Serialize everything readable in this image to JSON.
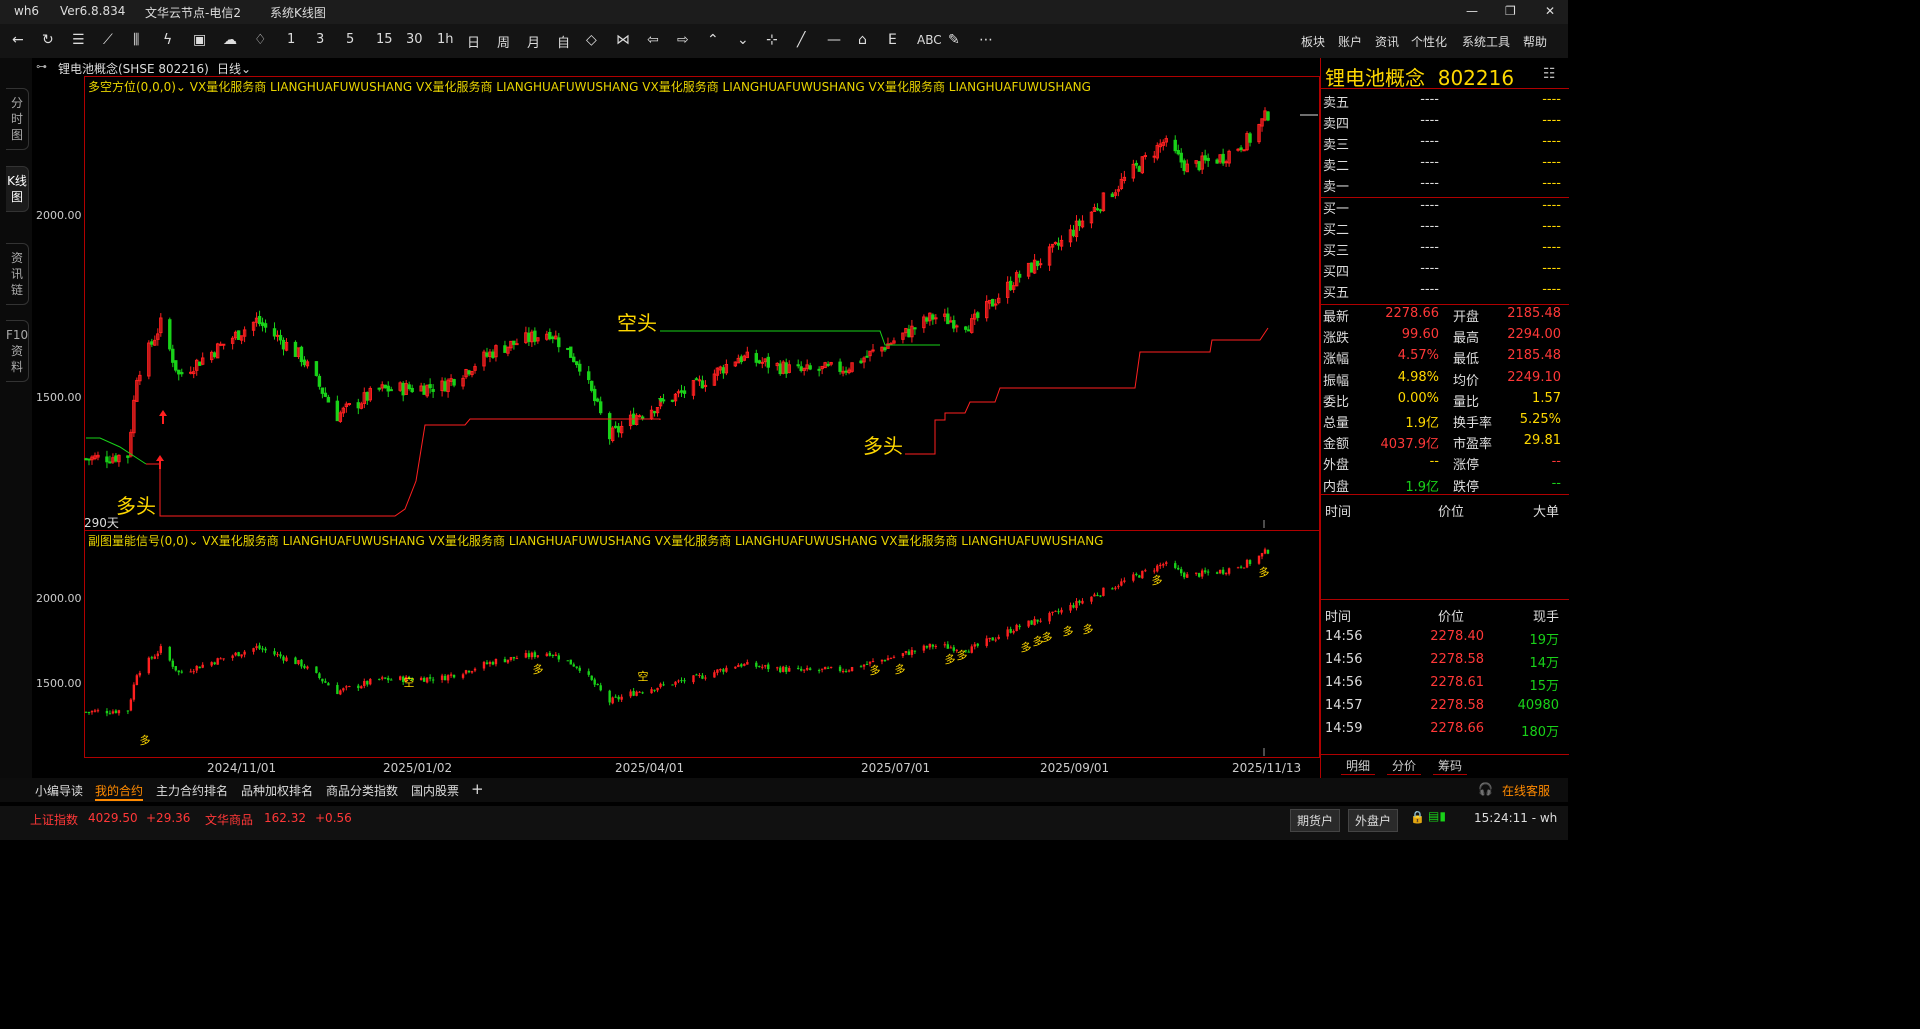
{
  "window": {
    "app": "wh6",
    "version": "Ver6.8.834",
    "server": "文华云节点-电信2",
    "view": "系统K线图"
  },
  "toolbar": {
    "periods": [
      "1",
      "3",
      "5",
      "15",
      "30",
      "1h",
      "日",
      "周",
      "月",
      "自"
    ],
    "text_tools": [
      "ABC"
    ],
    "menus": [
      "板块",
      "账户",
      "资讯",
      "个性化",
      "系统工具",
      "帮助"
    ]
  },
  "left_tabs": [
    "分时图",
    "K线图",
    "资讯链",
    "F10资料"
  ],
  "chart": {
    "instrument": "锂电池概念(SHSE 802216)",
    "period": "日线",
    "main_indicator": "多空方位(0,0,0)",
    "sub_indicator": "副图量能信号(0,0)",
    "ad_text": "VX量化服务商  LIANGHUAFUWUSHANG  VX量化服务商  LIANGHUAFUWUSHANG  VX量化服务商  LIANGHUAFUWUSHANG  VX量化服务商  LIANGHUAFUWUSHANG",
    "main_yticks": [
      "2000.00",
      "1500.00"
    ],
    "sub_yticks": [
      "2000.00",
      "1500.00"
    ],
    "xticks": [
      "2024/11/01",
      "2025/01/02",
      "2025/04/01",
      "2025/07/01",
      "2025/09/01",
      "2025/11/13"
    ],
    "days_label": "290天",
    "signal_labels": {
      "bull1": "多头",
      "bear": "空头",
      "bull2": "多头",
      "sub_bull": "多",
      "sub_bear": "空"
    }
  },
  "chart_data": {
    "type": "candlestick",
    "series": [
      {
        "name": "K线",
        "anchor_points": [
          [
            "2024/10/14",
            1330
          ],
          [
            "2024/10/28",
            1340
          ],
          [
            "2024/10/31",
            1560
          ],
          [
            "2024/11/08",
            1700
          ],
          [
            "2024/11/14",
            1560
          ],
          [
            "2024/11/28",
            1640
          ],
          [
            "2024/12/10",
            1710
          ],
          [
            "2024/12/25",
            1610
          ],
          [
            "2025/01/06",
            1450
          ],
          [
            "2025/01/20",
            1520
          ],
          [
            "2025/02/10",
            1530
          ],
          [
            "2025/02/28",
            1630
          ],
          [
            "2025/03/18",
            1680
          ],
          [
            "2025/03/28",
            1590
          ],
          [
            "2025/04/07",
            1390
          ],
          [
            "2025/04/16",
            1450
          ],
          [
            "2025/05/06",
            1530
          ],
          [
            "2025/05/20",
            1610
          ],
          [
            "2025/06/10",
            1570
          ],
          [
            "2025/06/25",
            1580
          ],
          [
            "2025/07/10",
            1650
          ],
          [
            "2025/07/24",
            1720
          ],
          [
            "2025/08/06",
            1700
          ],
          [
            "2025/08/20",
            1820
          ],
          [
            "2025/09/02",
            1900
          ],
          [
            "2025/09/20",
            2050
          ],
          [
            "2025/10/09",
            2200
          ],
          [
            "2025/10/17",
            2130
          ],
          [
            "2025/10/29",
            2160
          ],
          [
            "2025/11/07",
            2210
          ],
          [
            "2025/11/13",
            2278.66
          ]
        ]
      }
    ],
    "ylim": [
      1280,
      2320
    ]
  },
  "quote": {
    "name": "锂电池概念",
    "code": "802216",
    "asks": [
      [
        "卖五",
        "----",
        "----"
      ],
      [
        "卖四",
        "----",
        "----"
      ],
      [
        "卖三",
        "----",
        "----"
      ],
      [
        "卖二",
        "----",
        "----"
      ],
      [
        "卖一",
        "----",
        "----"
      ]
    ],
    "bids": [
      [
        "买一",
        "----",
        "----"
      ],
      [
        "买二",
        "----",
        "----"
      ],
      [
        "买三",
        "----",
        "----"
      ],
      [
        "买四",
        "----",
        "----"
      ],
      [
        "买五",
        "----",
        "----"
      ]
    ],
    "stats": [
      [
        "最新",
        "2278.66",
        "red",
        "开盘",
        "2185.48",
        "red"
      ],
      [
        "涨跌",
        "99.60",
        "red",
        "最高",
        "2294.00",
        "red"
      ],
      [
        "涨幅",
        "4.57%",
        "red",
        "最低",
        "2185.48",
        "red"
      ],
      [
        "振幅",
        "4.98%",
        "yellow",
        "均价",
        "2249.10",
        "red"
      ],
      [
        "委比",
        "0.00%",
        "yellow",
        "量比",
        "1.57",
        "yellow"
      ],
      [
        "总量",
        "1.9亿",
        "yellow",
        "换手率",
        "5.25%",
        "yellow"
      ],
      [
        "金额",
        "4037.9亿",
        "red",
        "市盈率",
        "29.81",
        "yellow"
      ],
      [
        "外盘",
        "--",
        "yellow",
        "涨停",
        "--",
        "red"
      ],
      [
        "内盘",
        "1.9亿",
        "green",
        "跌停",
        "--",
        "green"
      ]
    ],
    "tick_header1": [
      "时间",
      "价位",
      "大单"
    ],
    "tick_header2": [
      "时间",
      "价位",
      "现手"
    ],
    "ticks": [
      [
        "14:56",
        "2278.40",
        "19万",
        "green"
      ],
      [
        "14:56",
        "2278.58",
        "14万",
        "green"
      ],
      [
        "14:56",
        "2278.61",
        "15万",
        "green"
      ],
      [
        "14:57",
        "2278.58",
        "40980",
        "green"
      ],
      [
        "14:59",
        "2278.66",
        "180万",
        "green"
      ]
    ],
    "bottom_tabs": [
      "明细",
      "分价",
      "筹码"
    ]
  },
  "bottom_tabs": [
    "小编导读",
    "我的合约",
    "主力合约排名",
    "品种加权排名",
    "商品分类指数",
    "国内股票"
  ],
  "status": {
    "idx1_name": "上证指数",
    "idx1_val": "4029.50",
    "idx1_chg": "+29.36",
    "idx2_name": "文华商品",
    "idx2_val": "162.32",
    "idx2_chg": "+0.56",
    "service": "在线客服",
    "btn1": "期货户",
    "btn2": "外盘户",
    "time": "15:24:11 - wh"
  },
  "colors": {
    "up": "#ff2020",
    "down": "#19d219",
    "signal": "#ffd800",
    "border": "#b00000"
  }
}
